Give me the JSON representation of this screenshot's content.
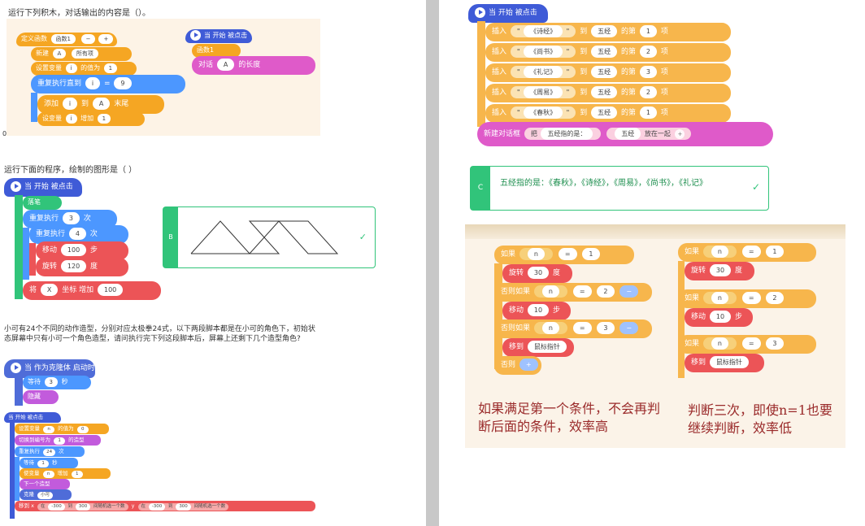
{
  "q1": {
    "prompt": "运行下列积木，对话输出的内容是（）。",
    "def": "定义函数",
    "fname": "函数1",
    "newlist": "新建",
    "listA": "A",
    "all": "所有项",
    "setvar": "设置变量",
    "vi": "i",
    "to": "的值为",
    "one": "1",
    "repeat_until": "重复执行直到",
    "eq": "=",
    "nine": "9",
    "add": "添加",
    "into": "到",
    "tail": "末尾",
    "change": "设变量",
    "inc": "增加",
    "hat": "当 开始 被点击",
    "call": "函数1",
    "say": "对话",
    "len": "的长度",
    "marker": "0"
  },
  "q2": {
    "prompt": "运行下面的程序，绘制的图形是（ ）",
    "hat": "当 开始 被点击",
    "pen": "落笔",
    "rep": "重复执行",
    "three": "3",
    "times": "次",
    "four": "4",
    "move": "移动",
    "hundred": "100",
    "step": "步",
    "turn": "旋转",
    "deg120": "120",
    "deg": "度",
    "setx": "将",
    "x": "X",
    "xinc": "坐标 增加",
    "x100": "100",
    "option_letter": "B"
  },
  "q3": {
    "prompt": "小可有24个不同的动作造型，分别对应太极拳24式，以下两段脚本都是在小可的角色下，初始状态屏幕中只有小可一个角色造型，请问执行完下列这段脚本后，屏幕上还剩下几个造型角色?",
    "clone_hat": "当 作为克隆体 启动时",
    "wait": "等待",
    "three": "3",
    "sec": "秒",
    "hide": "隐藏",
    "hat": "当 开始 被点击",
    "s1": "设置变量",
    "n": "n",
    "s1b": "的值为",
    "zero": "0",
    "s2": "切换到编号为",
    "s2b": "的造型",
    "r": "重复执行",
    "r24": "24",
    "rt": "次",
    "w": "等待",
    "w1": "1",
    "ws": "秒",
    "chg": "使变量",
    "chgb": "增加",
    "next": "下一个造型",
    "clone": "克隆",
    "self": "小可",
    "goto": "移到 x",
    "from": "在",
    "m300": "-300",
    "and": "到",
    "p300": "300",
    "rand": "间随机选一个数",
    "y": "y"
  },
  "r1": {
    "hat": "当 开始 被点击",
    "insert": "插入",
    "rows": [
      {
        "book": "《诗经》",
        "pos": "1"
      },
      {
        "book": "《尚书》",
        "pos": "2"
      },
      {
        "book": "《礼记》",
        "pos": "3"
      },
      {
        "book": "《周易》",
        "pos": "2"
      },
      {
        "book": "《春秋》",
        "pos": "1"
      }
    ],
    "to": "到",
    "list": "五经",
    "of": "的第",
    "item": "项",
    "newdlg": "新建对话框",
    "join": "把",
    "jointxt": "五经指的是：",
    "with": "放在一起"
  },
  "r2": {
    "letter": "C",
    "answer": "五经指的是：《春秋》，《诗经》，《周易》，《尚书》，《礼记》"
  },
  "r3": {
    "if": "如果",
    "n": "n",
    "eq": "=",
    "v1": "1",
    "v2": "2",
    "v3": "3",
    "turn": "旋转",
    "thirty": "30",
    "deg": "度",
    "elif": "否则如果",
    "move": "移动",
    "ten": "10",
    "step": "步",
    "goto": "移到",
    "mouse": "鼠标指针",
    "else": "否则",
    "note_left": "如果满足第一个条件，不会再判断后面的条件，效率高",
    "note_right": "判断三次，即使n=1也要继续判断，效率低"
  },
  "colors": {
    "accent_green": "#31c47a",
    "answer_border": "#31c47a"
  }
}
